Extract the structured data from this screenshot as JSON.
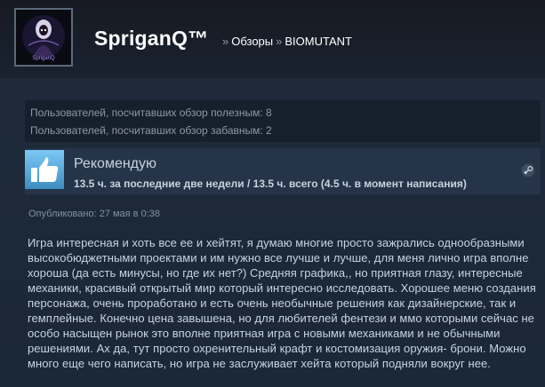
{
  "header": {
    "username": "SpriganQ™",
    "breadcrumb_sep": "»",
    "breadcrumb_reviews": "Обзоры",
    "breadcrumb_game": "BIOMUTANT",
    "avatar_text": "SpriganQ"
  },
  "votes": {
    "helpful": "Пользователей, посчитавших обзор полезным: 8",
    "funny": "Пользователей, посчитавших обзор забавным: 2"
  },
  "recommendation": {
    "title": "Рекомендую",
    "hours": "13.5 ч. за последние две недели / 13.5 ч. всего (4.5 ч. в момент написания)",
    "icon": "thumbs-up-icon"
  },
  "posted": "Опубликовано: 27 мая в 0:38",
  "review_lines": [
    "Игра интересная и хоть все ее и хейтят, я думаю многие просто зажрались однообразными",
    "высокобюджетными проектами и им нужно все лучше и лучше, для меня лично игра вполне",
    "хороша (да есть минусы, но где их нет?) Средняя графика,, но приятная глазу, интересные",
    "механики, красивый открытый мир который интересно исследовать. Хорошее меню создания",
    "персонажа, очень проработано и есть очень необычные решения как дизайнерские, так и",
    "гемплейные. Конечно цена завышена, но для любителей фентези и ммо которыми сейчас не",
    "особо насыщен рынок это вполне приятная игра с новыми механиками и не обычными",
    "решениями. Ах да, тут просто охренительный крафт и костомизация оружия- брони. Можно",
    "много еще чего написать, но игра не заслуживает хейта который подняли вокруг нее."
  ],
  "colors": {
    "background": "#1b2838",
    "accent": "#66c0f4",
    "text": "#c6d4df",
    "muted": "#8f98a0"
  }
}
